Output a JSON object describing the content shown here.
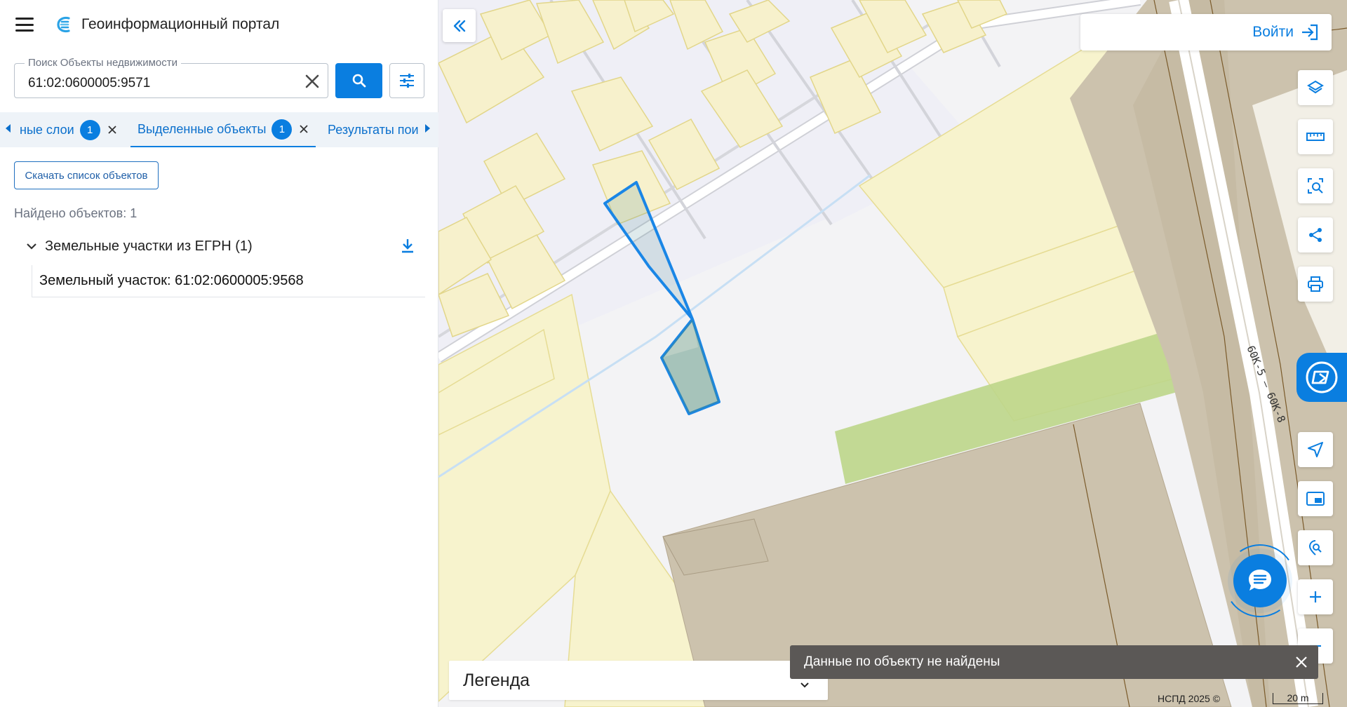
{
  "app": {
    "title": "Геоинформационный портал"
  },
  "search": {
    "label": "Поиск Объекты недвижимости",
    "value": "61:02:0600005:9571"
  },
  "tabs": [
    {
      "label": "ные слои",
      "badge": "1"
    },
    {
      "label": "Выделенные объекты",
      "badge": "1"
    },
    {
      "label": "Результаты пои"
    }
  ],
  "panel": {
    "download_list_label": "Скачать список объектов",
    "found_count": "Найдено объектов: 1",
    "group_title": "Земельные участки из ЕГРН (1)",
    "items": [
      {
        "label": "Земельный участок: 61:02:0600005:9568"
      }
    ]
  },
  "map": {
    "login_label": "Войти",
    "legend_label": "Легенда",
    "toast_text": "Данные по объекту не найдены",
    "attribution": "НСПД 2025 ©",
    "scale_label": "20 m",
    "road_label": "60К-5 – 60К-8",
    "road_label_top": "8",
    "tools": [
      "layers-icon",
      "ruler-icon",
      "area-search-icon",
      "share-icon",
      "print-icon",
      "assistant-icon",
      "navigate-icon",
      "minimap-icon",
      "geo-search-icon",
      "zoom-in-icon",
      "zoom-out-icon"
    ]
  },
  "colors": {
    "accent": "#0a7ee0",
    "parcel_fill": "#f7f1cc",
    "parcel_stroke": "#e4d98a",
    "building": "#ccc2ad",
    "green_zone": "#bcd68a",
    "highlight": "#1a86e6"
  }
}
